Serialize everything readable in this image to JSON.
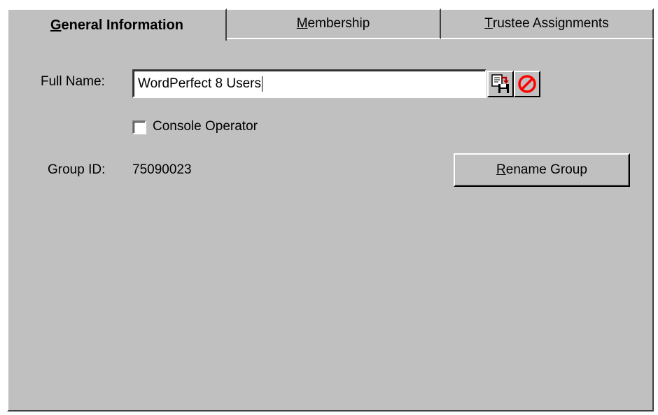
{
  "tabs": [
    {
      "label_underlined": "G",
      "label_rest": "eneral Information",
      "active": true
    },
    {
      "label_underlined": "M",
      "label_rest": "embership",
      "active": false
    },
    {
      "label_underlined": "T",
      "label_rest": "rustee Assignments",
      "active": false
    }
  ],
  "form": {
    "full_name_label": "Full Name:",
    "full_name_value": "WordPerfect 8 Users",
    "console_operator_label": "Console Operator",
    "console_operator_checked": false,
    "group_id_label": "Group ID:",
    "group_id_value": "75090023",
    "rename_button_underlined": "R",
    "rename_button_rest": "ename Group"
  },
  "icons": {
    "copy_save": "copy-save-icon",
    "cancel": "no-entry-icon"
  },
  "colors": {
    "face": "#c0c0c0",
    "cancel_red": "#ff0000"
  }
}
